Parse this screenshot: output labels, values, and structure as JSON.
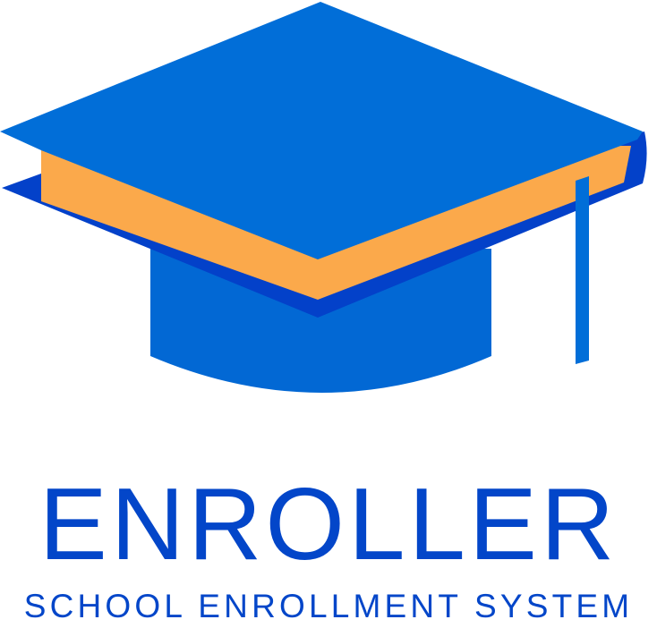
{
  "brand": {
    "name": "ENROLLER",
    "tagline": "SCHOOL ENROLLMENT SYSTEM"
  },
  "logo": {
    "icon": "graduation-cap-icon"
  },
  "colors": {
    "cap_top": "#016ed8",
    "cap_base": "#0268d4",
    "book_edge": "#0341c9",
    "book_pages": "#fba94b",
    "tassel": "#016ed8",
    "brand_text": "#0346c9"
  }
}
